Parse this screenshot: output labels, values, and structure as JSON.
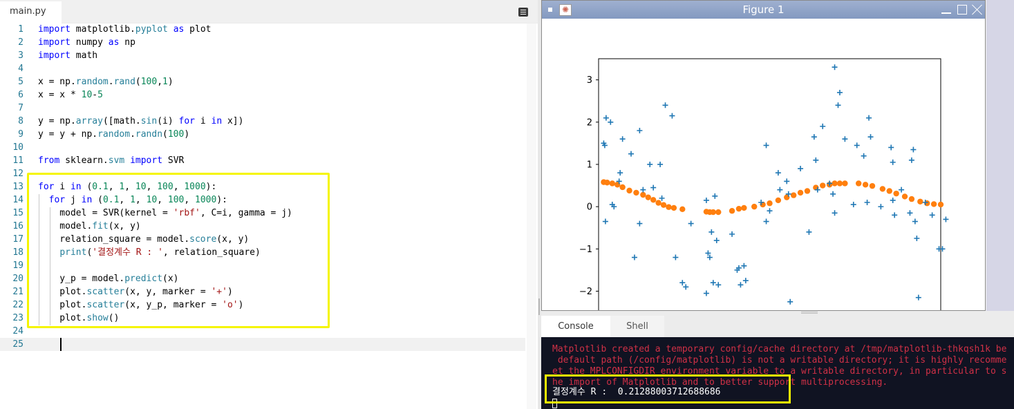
{
  "editor": {
    "tab_label": "main.py",
    "lines": [
      {
        "num": "1",
        "html": "<span class=\"k\">import</span> matplotlib.<span class=\"at\">pyplot</span> <span class=\"k\">as</span> plot"
      },
      {
        "num": "2",
        "html": "<span class=\"k\">import</span> numpy <span class=\"k\">as</span> np"
      },
      {
        "num": "3",
        "html": "<span class=\"k\">import</span> math"
      },
      {
        "num": "4",
        "html": ""
      },
      {
        "num": "5",
        "html": "x = np.<span class=\"at\">random</span>.<span class=\"at\">rand</span>(<span class=\"n\">100</span>,<span class=\"n\">1</span>)"
      },
      {
        "num": "6",
        "html": "x = x * <span class=\"n\">10</span>-<span class=\"n\">5</span>"
      },
      {
        "num": "7",
        "html": ""
      },
      {
        "num": "8",
        "html": "y = np.<span class=\"at\">array</span>([math.<span class=\"at\">sin</span>(i) <span class=\"k\">for</span> i <span class=\"k\">in</span> x])"
      },
      {
        "num": "9",
        "html": "y = y + np.<span class=\"at\">random</span>.<span class=\"at\">randn</span>(<span class=\"n\">100</span>)"
      },
      {
        "num": "10",
        "html": ""
      },
      {
        "num": "11",
        "html": "<span class=\"k\">from</span> sklearn.<span class=\"at\">svm</span> <span class=\"k\">import</span> SVR"
      },
      {
        "num": "12",
        "html": ""
      },
      {
        "num": "13",
        "html": "<span class=\"k\">for</span> i <span class=\"k\">in</span> (<span class=\"n\">0.1</span>, <span class=\"n\">1</span>, <span class=\"n\">10</span>, <span class=\"n\">100</span>, <span class=\"n\">1000</span>):"
      },
      {
        "num": "14",
        "html": "  <span class=\"k\">for</span> j <span class=\"k\">in</span> (<span class=\"n\">0.1</span>, <span class=\"n\">1</span>, <span class=\"n\">10</span>, <span class=\"n\">100</span>, <span class=\"n\">1000</span>):"
      },
      {
        "num": "15",
        "html": "    model = SVR(kernel = <span class=\"s\">'rbf'</span>, C=i, gamma = j)"
      },
      {
        "num": "16",
        "html": "    model.<span class=\"at\">fit</span>(x, y)"
      },
      {
        "num": "17",
        "html": "    relation_square = model.<span class=\"at\">score</span>(x, y)"
      },
      {
        "num": "18",
        "html": "    <span class=\"at\">print</span>(<span class=\"s\">'결정계수 R : '</span>, relation_square)"
      },
      {
        "num": "19",
        "html": ""
      },
      {
        "num": "20",
        "html": "    y_p = model.<span class=\"at\">predict</span>(x)"
      },
      {
        "num": "21",
        "html": "    plot.<span class=\"at\">scatter</span>(x, y, marker = <span class=\"s\">'+'</span>)"
      },
      {
        "num": "22",
        "html": "    plot.<span class=\"at\">scatter</span>(x, y_p, marker = <span class=\"s\">'o'</span>)"
      },
      {
        "num": "23",
        "html": "    plot.<span class=\"at\">show</span>()"
      },
      {
        "num": "24",
        "html": ""
      },
      {
        "num": "25",
        "html": ""
      }
    ]
  },
  "figure": {
    "window_title": "Figure 1"
  },
  "console": {
    "tab_console": "Console",
    "tab_shell": "Shell",
    "warning_lines": [
      "Matplotlib created a temporary config/cache directory at /tmp/matplotlib-thkqsh1k be",
      " default path (/config/matplotlib) is not a writable directory; it is highly recomme",
      "et the MPLCONFIGDIR environment variable to a writable directory, in particular to s",
      "he import of Matplotlib and to better support multiprocessing."
    ],
    "result_line": "결정계수 R :  0.21288003712688686"
  },
  "colors": {
    "plus_series": "#1f77b4",
    "circle_series": "#ff7f0e",
    "highlight": "#f5f500"
  },
  "chart_data": {
    "type": "scatter",
    "title": "",
    "xlabel": "",
    "ylabel": "",
    "y_ticks": [
      3,
      2,
      1,
      0,
      -1,
      -2
    ],
    "y_tick_labels": [
      "3",
      "2",
      "1",
      "0",
      "−1",
      "−2"
    ],
    "xlim": [
      -5,
      5
    ],
    "ylim": [
      -2.45,
      3.5
    ],
    "series": [
      {
        "marker": "+",
        "points": [
          [
            -4.85,
            1.5
          ],
          [
            -4.82,
            1.45
          ],
          [
            -4.78,
            2.1
          ],
          [
            -4.8,
            -0.35
          ],
          [
            -4.65,
            2.0
          ],
          [
            -4.6,
            0.05
          ],
          [
            -4.55,
            0.0
          ],
          [
            -4.4,
            0.6
          ],
          [
            -4.37,
            0.8
          ],
          [
            -4.3,
            1.6
          ],
          [
            -4.05,
            1.25
          ],
          [
            -3.95,
            -1.2
          ],
          [
            -3.8,
            1.8
          ],
          [
            -3.8,
            -0.4
          ],
          [
            -3.7,
            0.4
          ],
          [
            -3.5,
            1.0
          ],
          [
            -3.4,
            0.45
          ],
          [
            -3.2,
            1.0
          ],
          [
            -3.15,
            0.2
          ],
          [
            -3.05,
            2.4
          ],
          [
            -2.85,
            2.15
          ],
          [
            -2.75,
            -1.2
          ],
          [
            -2.55,
            -1.8
          ],
          [
            -2.45,
            -1.9
          ],
          [
            -2.3,
            -0.4
          ],
          [
            -1.85,
            -2.05
          ],
          [
            -1.85,
            0.15
          ],
          [
            -1.8,
            -1.1
          ],
          [
            -1.75,
            -1.2
          ],
          [
            -1.7,
            -0.6
          ],
          [
            -1.65,
            -1.8
          ],
          [
            -1.6,
            0.25
          ],
          [
            -1.55,
            -0.8
          ],
          [
            -1.5,
            -1.85
          ],
          [
            -1.1,
            -0.65
          ],
          [
            -0.95,
            -1.5
          ],
          [
            -0.9,
            -1.45
          ],
          [
            -0.85,
            -1.85
          ],
          [
            -0.75,
            -1.4
          ],
          [
            -0.7,
            -1.75
          ],
          [
            -0.25,
            0.1
          ],
          [
            -0.1,
            1.45
          ],
          [
            -0.1,
            -0.35
          ],
          [
            0.0,
            -0.1
          ],
          [
            0.25,
            0.8
          ],
          [
            0.3,
            0.4
          ],
          [
            0.5,
            0.6
          ],
          [
            0.55,
            0.3
          ],
          [
            0.6,
            -2.25
          ],
          [
            0.9,
            0.9
          ],
          [
            1.15,
            -0.6
          ],
          [
            1.3,
            1.65
          ],
          [
            1.35,
            1.1
          ],
          [
            1.4,
            0.4
          ],
          [
            1.55,
            1.9
          ],
          [
            1.75,
            0.55
          ],
          [
            1.85,
            0.3
          ],
          [
            1.9,
            -0.15
          ],
          [
            1.9,
            3.3
          ],
          [
            2.0,
            2.4
          ],
          [
            2.05,
            2.7
          ],
          [
            2.2,
            1.6
          ],
          [
            2.45,
            0.05
          ],
          [
            2.55,
            1.45
          ],
          [
            2.75,
            1.2
          ],
          [
            2.85,
            0.1
          ],
          [
            2.9,
            2.1
          ],
          [
            2.95,
            1.65
          ],
          [
            3.25,
            0.0
          ],
          [
            3.55,
            1.4
          ],
          [
            3.6,
            1.05
          ],
          [
            3.6,
            0.15
          ],
          [
            3.65,
            -0.2
          ],
          [
            3.85,
            0.4
          ],
          [
            4.1,
            -0.15
          ],
          [
            4.15,
            1.1
          ],
          [
            4.2,
            1.35
          ],
          [
            4.25,
            -0.35
          ],
          [
            4.3,
            -0.75
          ],
          [
            4.35,
            -2.15
          ],
          [
            4.55,
            0.1
          ],
          [
            4.75,
            -0.2
          ],
          [
            4.95,
            -1.0
          ],
          [
            5.05,
            -1.0
          ],
          [
            5.15,
            -0.3
          ]
        ]
      },
      {
        "marker": "o",
        "points": [
          [
            -4.85,
            0.58
          ],
          [
            -4.75,
            0.57
          ],
          [
            -4.6,
            0.55
          ],
          [
            -4.45,
            0.52
          ],
          [
            -4.3,
            0.46
          ],
          [
            -4.1,
            0.38
          ],
          [
            -3.9,
            0.33
          ],
          [
            -3.7,
            0.28
          ],
          [
            -3.55,
            0.22
          ],
          [
            -3.4,
            0.16
          ],
          [
            -3.25,
            0.09
          ],
          [
            -3.1,
            0.04
          ],
          [
            -2.95,
            -0.01
          ],
          [
            -2.8,
            -0.03
          ],
          [
            -2.55,
            -0.06
          ],
          [
            -1.85,
            -0.12
          ],
          [
            -1.75,
            -0.13
          ],
          [
            -1.65,
            -0.13
          ],
          [
            -1.5,
            -0.13
          ],
          [
            -1.1,
            -0.1
          ],
          [
            -0.9,
            -0.05
          ],
          [
            -0.75,
            -0.03
          ],
          [
            -0.45,
            0.0
          ],
          [
            -0.2,
            0.05
          ],
          [
            0.0,
            0.08
          ],
          [
            0.25,
            0.15
          ],
          [
            0.5,
            0.22
          ],
          [
            0.7,
            0.27
          ],
          [
            0.9,
            0.33
          ],
          [
            1.1,
            0.37
          ],
          [
            1.35,
            0.45
          ],
          [
            1.55,
            0.5
          ],
          [
            1.75,
            0.52
          ],
          [
            1.9,
            0.55
          ],
          [
            2.05,
            0.55
          ],
          [
            2.2,
            0.55
          ],
          [
            2.6,
            0.55
          ],
          [
            2.8,
            0.52
          ],
          [
            3.0,
            0.49
          ],
          [
            3.3,
            0.42
          ],
          [
            3.5,
            0.37
          ],
          [
            3.7,
            0.31
          ],
          [
            3.95,
            0.24
          ],
          [
            4.15,
            0.18
          ],
          [
            4.4,
            0.12
          ],
          [
            4.6,
            0.08
          ],
          [
            4.8,
            0.06
          ],
          [
            5.0,
            0.05
          ]
        ]
      }
    ]
  }
}
